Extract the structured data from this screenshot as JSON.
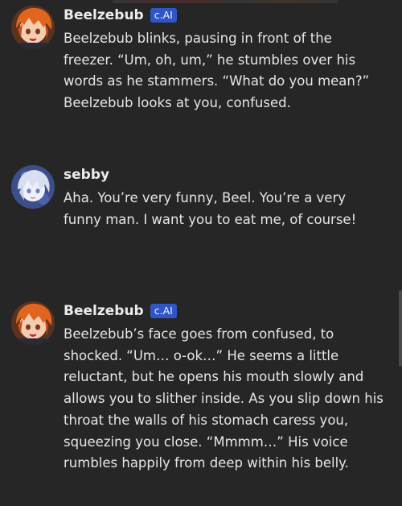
{
  "messages": [
    {
      "author": "Beelzebub",
      "badge": "c.AI",
      "avatar_icon": "orange-haired-anime-avatar",
      "text": "Beelzebub blinks, pausing in front of the freezer. “Um, oh, um,” he stumbles over his words as he stammers. “What do you mean?” Beelzebub looks at you, confused."
    },
    {
      "author": "sebby",
      "badge": "",
      "avatar_icon": "white-haired-anime-avatar",
      "text": "Aha. You’re very funny, Beel. You’re a very funny man. I want you to eat me, of course!"
    },
    {
      "author": "Beelzebub",
      "badge": "c.AI",
      "avatar_icon": "orange-haired-anime-avatar",
      "text": "Beelzebub’s face goes from confused, to shocked. “Um… o-ok…” He seems a little reluctant, but he opens his mouth slowly and allows you to slither inside. As you slip down his throat the walls of his stomach caress you, squeezing you close. “Mmmm…” His voice rumbles happily from deep within his belly."
    }
  ],
  "colors": {
    "background": "#262626",
    "badge": "#2f56c6",
    "text": "#e6e6e6"
  }
}
